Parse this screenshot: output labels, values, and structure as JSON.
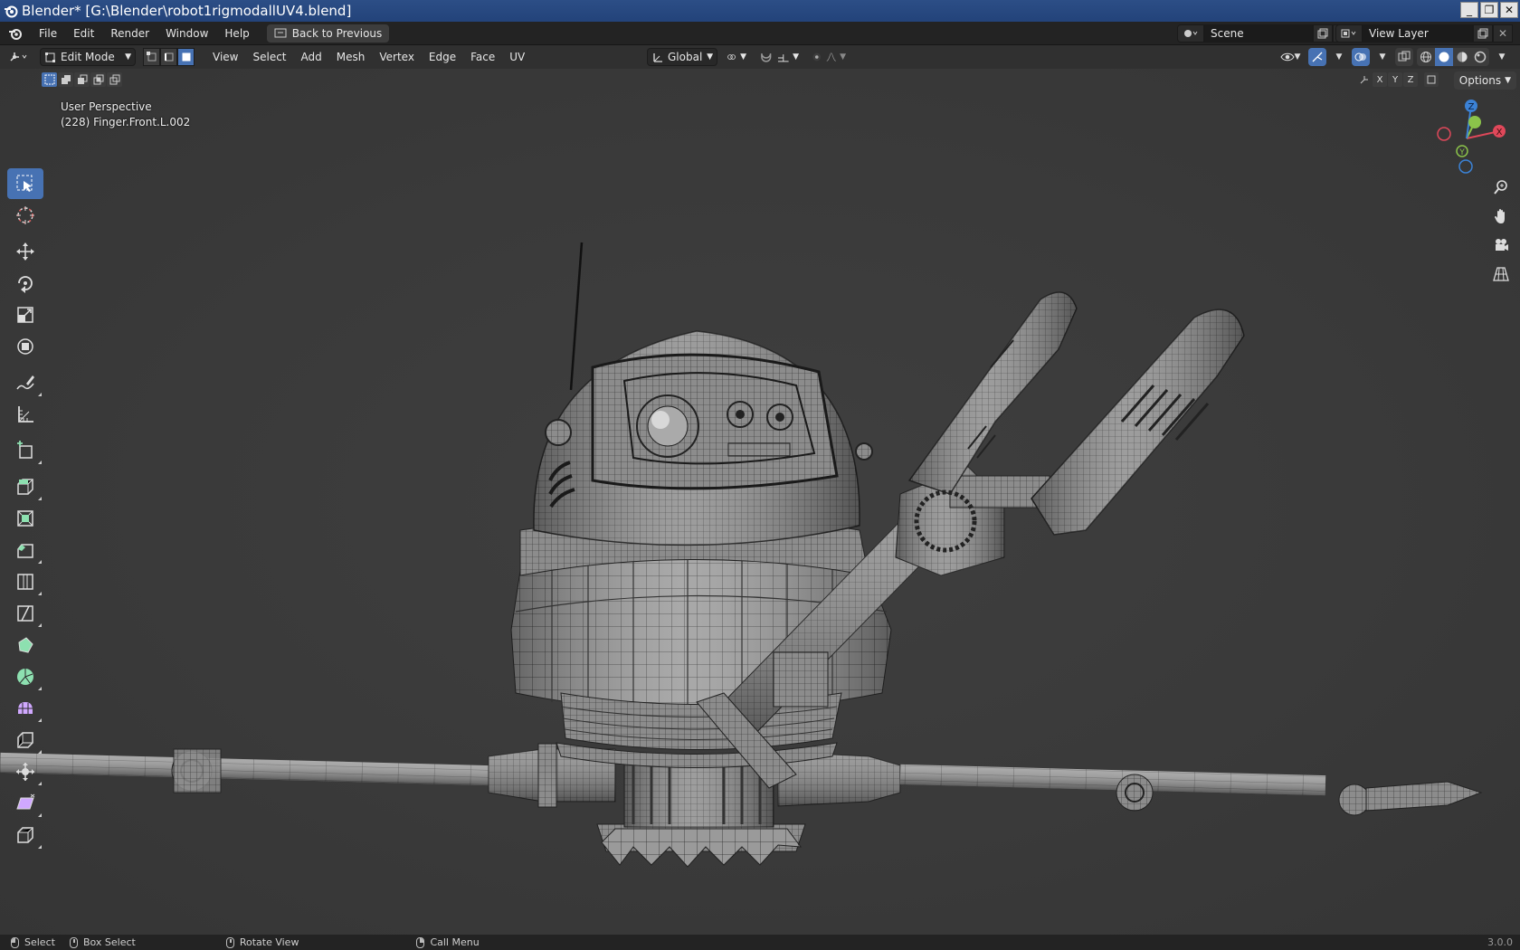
{
  "window": {
    "title": "Blender* [G:\\Blender\\robot1rigmodallUV4.blend]",
    "controls": [
      "_",
      "❐",
      "✕"
    ]
  },
  "menubar": {
    "items": [
      "File",
      "Edit",
      "Render",
      "Window",
      "Help"
    ],
    "back_button": "Back to Previous",
    "scene_name": "Scene",
    "view_layer_name": "View Layer"
  },
  "header3d": {
    "mode": "Edit Mode",
    "menus": [
      "View",
      "Select",
      "Add",
      "Mesh",
      "Vertex",
      "Edge",
      "Face",
      "UV"
    ],
    "transform_orientation": "Global",
    "select_mode_active": "face"
  },
  "viewport": {
    "view_name": "User Perspective",
    "active_object": "(228) Finger.Front.L.002",
    "axis_lock": [
      "X",
      "Y",
      "Z"
    ],
    "options_label": "Options",
    "gizmo_axes": [
      "X",
      "Y",
      "Z"
    ]
  },
  "toolbar": {
    "tools": [
      "select-box",
      "cursor",
      "move",
      "rotate",
      "scale",
      "transform",
      "annotate",
      "measure",
      "add-cube",
      "extrude-region",
      "inset-faces",
      "bevel",
      "loop-cut",
      "knife",
      "poly-build",
      "spin",
      "smooth",
      "edge-slide",
      "shrink-fatten",
      "shear",
      "rip-region"
    ],
    "active_tool": "select-box"
  },
  "statusbar": {
    "select": "Select",
    "box_select": "Box Select",
    "rotate_view": "Rotate View",
    "call_menu": "Call Menu",
    "version": "3.0.0"
  },
  "colors": {
    "accent": "#4772b3",
    "viewport_bg": "#3d3d3d",
    "header_bg": "#303030",
    "axis_x": "#e0485a",
    "axis_y": "#8bc34a",
    "axis_z": "#3b82d6"
  }
}
